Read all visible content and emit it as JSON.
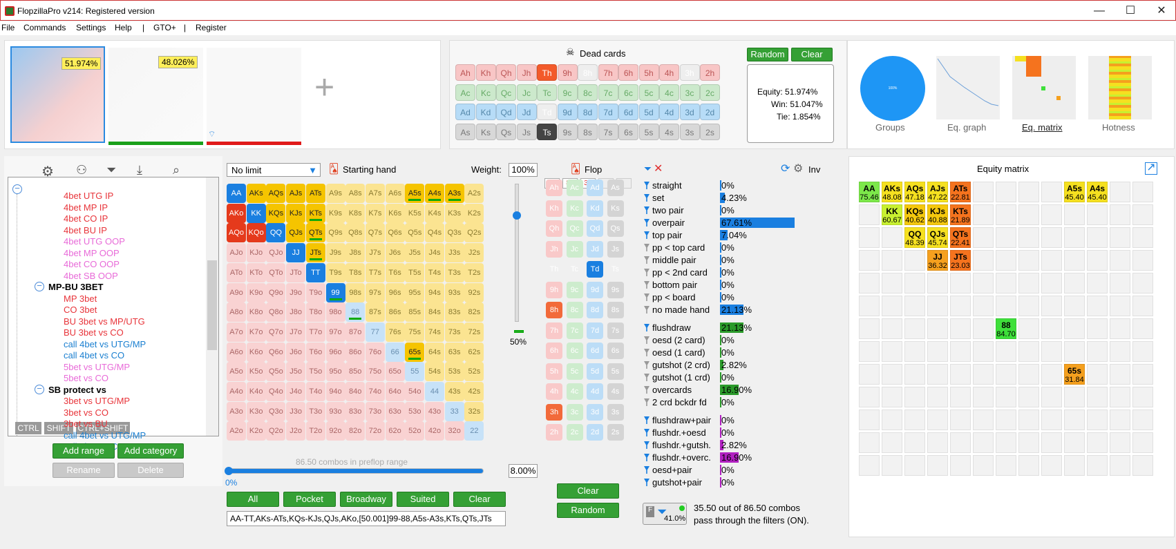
{
  "window": {
    "title": "FlopzillaPro v214: Registered version",
    "minimize": "—",
    "maximize": "☐",
    "close": "✕"
  },
  "menu": [
    "File",
    "Commands",
    "Settings",
    "Help",
    "|",
    "GTO+",
    "|",
    "Register"
  ],
  "ranges": {
    "r1_equity": "51.974%",
    "r2_equity": "48.026%",
    "add": "+"
  },
  "dead_cards": {
    "title": "Dead cards",
    "random": "Random",
    "clear": "Clear",
    "rows": [
      [
        "Ah",
        "Kh",
        "Qh",
        "Jh",
        "Th",
        "9h",
        "8h",
        "7h",
        "6h",
        "5h",
        "4h",
        "3h",
        "2h"
      ],
      [
        "Ac",
        "Kc",
        "Qc",
        "Jc",
        "Tc",
        "9c",
        "8c",
        "7c",
        "6c",
        "5c",
        "4c",
        "3c",
        "2c"
      ],
      [
        "Ad",
        "Kd",
        "Qd",
        "Jd",
        "Td",
        "9d",
        "8d",
        "7d",
        "6d",
        "5d",
        "4d",
        "3d",
        "2d"
      ],
      [
        "As",
        "Ks",
        "Qs",
        "Js",
        "Ts",
        "9s",
        "8s",
        "7s",
        "6s",
        "5s",
        "4s",
        "3s",
        "2s"
      ]
    ]
  },
  "equity_box": {
    "equity": "Equity: 51.974%",
    "win": "Win: 51.047%",
    "tie": "Tie: 1.854%"
  },
  "views": {
    "groups": "Groups",
    "eq_graph": "Eq. graph",
    "eq_matrix": "Eq. matrix",
    "hotness": "Hotness",
    "group_pct": "100%"
  },
  "tree": {
    "items": [
      {
        "text": "4bet UTG IP",
        "color": "#e8343a"
      },
      {
        "text": "4bet MP IP",
        "color": "#e8343a"
      },
      {
        "text": "4bet CO IP",
        "color": "#e8343a"
      },
      {
        "text": "4bet BU IP",
        "color": "#e8343a"
      },
      {
        "text": "4bet UTG OOP",
        "color": "#e86ad8"
      },
      {
        "text": "4bet MP OOP",
        "color": "#e86ad8"
      },
      {
        "text": "4bet CO OOP",
        "color": "#e86ad8"
      },
      {
        "text": "4bet SB OOP",
        "color": "#e86ad8"
      },
      {
        "text": "MP-BU 3BET",
        "color": "#000",
        "bold": true
      },
      {
        "text": "MP 3bet",
        "color": "#e8343a"
      },
      {
        "text": "CO 3bet",
        "color": "#e8343a"
      },
      {
        "text": "BU 3bet vs MP/UTG",
        "color": "#e8343a"
      },
      {
        "text": "BU 3bet vs CO",
        "color": "#e8343a"
      },
      {
        "text": "call 4bet vs UTG/MP",
        "color": "#1a7fd0"
      },
      {
        "text": "call 4bet vs CO",
        "color": "#1a7fd0"
      },
      {
        "text": "5bet vs UTG/MP",
        "color": "#e86ad8"
      },
      {
        "text": "5bet vs CO",
        "color": "#e86ad8"
      },
      {
        "text": "SB protect vs",
        "color": "#000",
        "bold": true
      },
      {
        "text": "3bet vs UTG/MP",
        "color": "#e8343a"
      },
      {
        "text": "3bet vs CO",
        "color": "#e8343a"
      },
      {
        "text": "3bet vs BU",
        "color": "#e8343a"
      },
      {
        "text": "call 4bet vs UTG/MP",
        "color": "#1a7fd0"
      },
      {
        "text": "call 4bet vs CO",
        "color": "#1a7fd0"
      }
    ],
    "ctrl": "CTRL",
    "shift": "SHIFT",
    "ctrlshift": "CTRL+SHIFT",
    "add_range": "Add range",
    "add_category": "Add category",
    "rename": "Rename",
    "delete": "Delete"
  },
  "starting": {
    "limit": "No limit",
    "title": "Starting hand",
    "weight_label": "Weight:",
    "weight_value": "100%",
    "slider_pct": "50%",
    "combos": "86.50 combos in preflop range",
    "range_pct": "8.00%",
    "range_low": "0%",
    "buttons": [
      "All",
      "Pocket",
      "Broadway",
      "Suited",
      "Clear"
    ],
    "range_text": "AA-TT,AKs-ATs,KQs-KJs,QJs,AKo,[50.001]99-88,A5s-A3s,KTs,QTs,JTs"
  },
  "matrix": {
    "ranks": [
      "A",
      "K",
      "Q",
      "J",
      "T",
      "9",
      "8",
      "7",
      "6",
      "5",
      "4",
      "3",
      "2"
    ],
    "selected": {
      "AA": "b",
      "AKs": "y",
      "AQs": "y",
      "AJs": "y",
      "ATs": "y",
      "AKo": "r",
      "KK": "b",
      "KQs": "y",
      "KJs": "y",
      "KTs": "y",
      "AQo": "r",
      "KQo": "r",
      "QQ": "b",
      "QJs": "y",
      "QTs": "y",
      "JJ": "b",
      "JTs": "y",
      "TT": "b",
      "99": "b",
      "88": "pb",
      "A5s": "y",
      "A4s": "y",
      "A3s": "y",
      "65s": "y"
    },
    "underlined": [
      "KTs",
      "QTs",
      "JTs",
      "99",
      "88",
      "A5s",
      "A4s",
      "A3s",
      "65s"
    ],
    "blue_pairs": [
      "77",
      "66",
      "55",
      "44",
      "33",
      "22"
    ]
  },
  "flop": {
    "title": "Flop",
    "board": [
      "T♦",
      "8♥",
      "3♥",
      "",
      ""
    ],
    "clear": "Clear",
    "random": "Random",
    "columns": [
      {
        "suit": "h",
        "cards": [
          "Ah",
          "Kh",
          "Qh",
          "Jh",
          "Th",
          "9h",
          "8h",
          "7h",
          "6h",
          "5h",
          "4h",
          "3h",
          "2h"
        ]
      },
      {
        "suit": "c",
        "cards": [
          "Ac",
          "Kc",
          "Qc",
          "Jc",
          "Tc",
          "9c",
          "8c",
          "7c",
          "6c",
          "5c",
          "4c",
          "3c",
          "2c"
        ]
      },
      {
        "suit": "d",
        "cards": [
          "Ad",
          "Kd",
          "Qd",
          "Jd",
          "Td",
          "9d",
          "8d",
          "7d",
          "6d",
          "5d",
          "4d",
          "3d",
          "2d"
        ]
      },
      {
        "suit": "s",
        "cards": [
          "As",
          "Ks",
          "Qs",
          "Js",
          "Ts",
          "9s",
          "8s",
          "7s",
          "6s",
          "5s",
          "4s",
          "3s",
          "2s"
        ]
      }
    ]
  },
  "stats": {
    "inv": "Inv",
    "rows": [
      {
        "name": "straight",
        "val": "0%",
        "on": true,
        "bar": 0,
        "color": "#1a7fe0"
      },
      {
        "name": "set",
        "val": "4.23%",
        "on": true,
        "bar": 0.0423,
        "color": "#1a7fe0"
      },
      {
        "name": "two pair",
        "val": "0%",
        "on": true,
        "bar": 0,
        "color": "#1a7fe0"
      },
      {
        "name": "overpair",
        "val": "67.61%",
        "on": true,
        "bar": 0.6761,
        "color": "#1a7fe0"
      },
      {
        "name": "top pair",
        "val": "7.04%",
        "on": true,
        "bar": 0.0704,
        "color": "#1a7fe0"
      },
      {
        "name": "pp < top card",
        "val": "0%",
        "on": false,
        "bar": 0,
        "color": "#1a7fe0"
      },
      {
        "name": "middle pair",
        "val": "0%",
        "on": false,
        "bar": 0,
        "color": "#1a7fe0"
      },
      {
        "name": "pp < 2nd card",
        "val": "0%",
        "on": false,
        "bar": 0,
        "color": "#1a7fe0"
      },
      {
        "name": "bottom pair",
        "val": "0%",
        "on": false,
        "bar": 0,
        "color": "#1a7fe0"
      },
      {
        "name": "pp < board",
        "val": "0%",
        "on": false,
        "bar": 0,
        "color": "#1a7fe0"
      },
      {
        "name": "no made hand",
        "val": "21.13%",
        "on": false,
        "bar": 0.2113,
        "color": "#1a7fe0"
      },
      {
        "name": "flushdraw",
        "val": "21.13%",
        "on": true,
        "bar": 0.2113,
        "color": "#2a9a2a"
      },
      {
        "name": "oesd (2 card)",
        "val": "0%",
        "on": false,
        "bar": 0,
        "color": "#2a9a2a"
      },
      {
        "name": "oesd (1 card)",
        "val": "0%",
        "on": false,
        "bar": 0,
        "color": "#2a9a2a"
      },
      {
        "name": "gutshot (2 crd)",
        "val": "2.82%",
        "on": false,
        "bar": 0.0282,
        "color": "#2a9a2a"
      },
      {
        "name": "gutshot (1 crd)",
        "val": "0%",
        "on": false,
        "bar": 0,
        "color": "#2a9a2a"
      },
      {
        "name": "overcards",
        "val": "16.90%",
        "on": false,
        "bar": 0.169,
        "color": "#2a9a2a"
      },
      {
        "name": "2 crd bckdr fd",
        "val": "0%",
        "on": false,
        "bar": 0,
        "color": "#2a9a2a"
      },
      {
        "name": "flushdraw+pair",
        "val": "0%",
        "on": true,
        "bar": 0,
        "color": "#b020c0"
      },
      {
        "name": "flushdr.+oesd",
        "val": "0%",
        "on": true,
        "bar": 0,
        "color": "#b020c0"
      },
      {
        "name": "flushdr.+gutsh.",
        "val": "2.82%",
        "on": true,
        "bar": 0.0282,
        "color": "#b020c0"
      },
      {
        "name": "flushdr.+overc.",
        "val": "16.90%",
        "on": true,
        "bar": 0.169,
        "color": "#b020c0"
      },
      {
        "name": "oesd+pair",
        "val": "0%",
        "on": true,
        "bar": 0,
        "color": "#b020c0"
      },
      {
        "name": "gutshot+pair",
        "val": "0%",
        "on": true,
        "bar": 0,
        "color": "#b020c0"
      }
    ],
    "filter_pct": "41.0%",
    "filter_text1": "35.50 out of 86.50 combos",
    "filter_text2": "pass through the filters (ON)."
  },
  "equity_matrix": {
    "title": "Equity matrix",
    "cells": [
      {
        "r": 0,
        "c": 0,
        "h": "AA",
        "v": "75.46",
        "color": "#7ce84a"
      },
      {
        "r": 0,
        "c": 1,
        "h": "AKs",
        "v": "48.08",
        "color": "#f5e020"
      },
      {
        "r": 0,
        "c": 2,
        "h": "AQs",
        "v": "47.18",
        "color": "#f5e020"
      },
      {
        "r": 0,
        "c": 3,
        "h": "AJs",
        "v": "47.22",
        "color": "#f5e020"
      },
      {
        "r": 0,
        "c": 4,
        "h": "ATs",
        "v": "22.81",
        "color": "#f5731e"
      },
      {
        "r": 0,
        "c": 9,
        "h": "A5s",
        "v": "45.40",
        "color": "#f5e020"
      },
      {
        "r": 0,
        "c": 10,
        "h": "A4s",
        "v": "45.40",
        "color": "#f5e020"
      },
      {
        "r": 1,
        "c": 1,
        "h": "KK",
        "v": "60.67",
        "color": "#c8f030"
      },
      {
        "r": 1,
        "c": 2,
        "h": "KQs",
        "v": "40.62",
        "color": "#f5c80e"
      },
      {
        "r": 1,
        "c": 3,
        "h": "KJs",
        "v": "40.88",
        "color": "#f5c80e"
      },
      {
        "r": 1,
        "c": 4,
        "h": "KTs",
        "v": "21.89",
        "color": "#f5731e"
      },
      {
        "r": 2,
        "c": 2,
        "h": "QQ",
        "v": "48.39",
        "color": "#f5e020"
      },
      {
        "r": 2,
        "c": 3,
        "h": "QJs",
        "v": "45.74",
        "color": "#f5e020"
      },
      {
        "r": 2,
        "c": 4,
        "h": "QTs",
        "v": "22.41",
        "color": "#f5731e"
      },
      {
        "r": 3,
        "c": 3,
        "h": "JJ",
        "v": "36.32",
        "color": "#f5a01e"
      },
      {
        "r": 3,
        "c": 4,
        "h": "JTs",
        "v": "23.03",
        "color": "#f5731e"
      },
      {
        "r": 6,
        "c": 6,
        "h": "88",
        "v": "84.70",
        "color": "#3ee03a"
      },
      {
        "r": 8,
        "c": 9,
        "h": "65s",
        "v": "31.84",
        "color": "#f5a01e"
      }
    ]
  }
}
